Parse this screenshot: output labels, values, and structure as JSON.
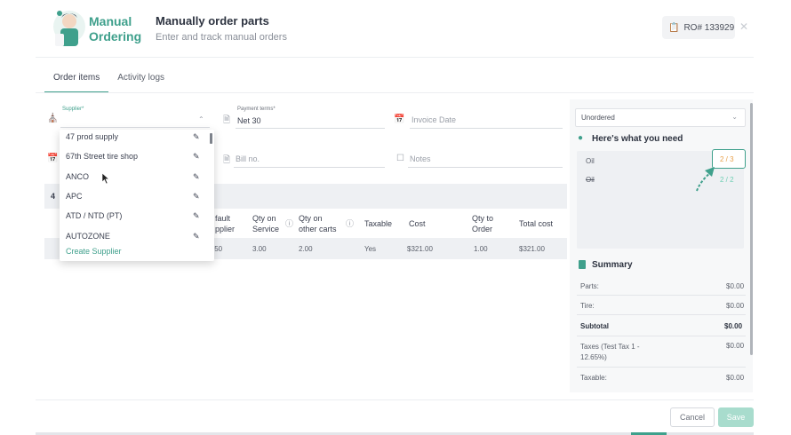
{
  "header": {
    "logo_line1": "Manual",
    "logo_line2": "Ordering",
    "title": "Manually order parts",
    "subtitle": "Enter and track manual orders",
    "ro_number": "RO# 133929"
  },
  "tabs": [
    {
      "label": "Order items",
      "active": true
    },
    {
      "label": "Activity logs",
      "active": false
    }
  ],
  "form": {
    "supplier_label": "Supplier*",
    "payment_terms_label": "Payment terms*",
    "payment_terms_value": "Net 30",
    "invoice_date_placeholder": "Invoice Date",
    "bill_no_placeholder": "Bill no.",
    "notes_placeholder": "Notes"
  },
  "supplier_dropdown": {
    "items": [
      "47 prod supply",
      "67th Street tire shop",
      "ANCO",
      "APC",
      "ATD / NTD (PT)",
      "AUTOZONE"
    ],
    "create_label": "Create Supplier"
  },
  "table": {
    "count": "4",
    "headers": {
      "default_supplier": [
        "fault",
        "pplier"
      ],
      "qty_on_service": [
        "Qty on",
        "Service"
      ],
      "qty_on_other_carts": [
        "Qty on",
        "other carts"
      ],
      "taxable": "Taxable",
      "cost": "Cost",
      "qty_to_order": [
        "Qty to",
        "Order"
      ],
      "total_cost": "Total cost"
    },
    "row": {
      "partial": " 50",
      "qty_on_service": "3.00",
      "qty_on_other_carts": "2.00",
      "taxable": "Yes",
      "cost": "$321.00",
      "qty_to_order": "1.00",
      "total_cost": "$321.00"
    }
  },
  "right_panel": {
    "status": "Unordered",
    "need_title": "Here's what you need",
    "need_items": [
      {
        "name": "Oil",
        "progress": "2 / 3"
      },
      {
        "name": "Oil",
        "progress": "2 / 2"
      }
    ],
    "summary_title": "Summary",
    "summary": {
      "parts_label": "Parts:",
      "parts_value": "$0.00",
      "tire_label": "Tire:",
      "tire_value": "$0.00",
      "subtotal_label": "Subtotal",
      "subtotal_value": "$0.00",
      "taxes_label": "Taxes (Test Tax 1 - 12.65%)",
      "taxes_value": "$0.00",
      "taxable_label": "Taxable:",
      "taxable_value": "$0.00"
    }
  },
  "footer": {
    "cancel_label": "Cancel",
    "save_label": "Save"
  },
  "colors": {
    "accent": "#3fa08c",
    "progress_partial": "#e8a04a",
    "progress_complete": "#6fcfb4"
  }
}
